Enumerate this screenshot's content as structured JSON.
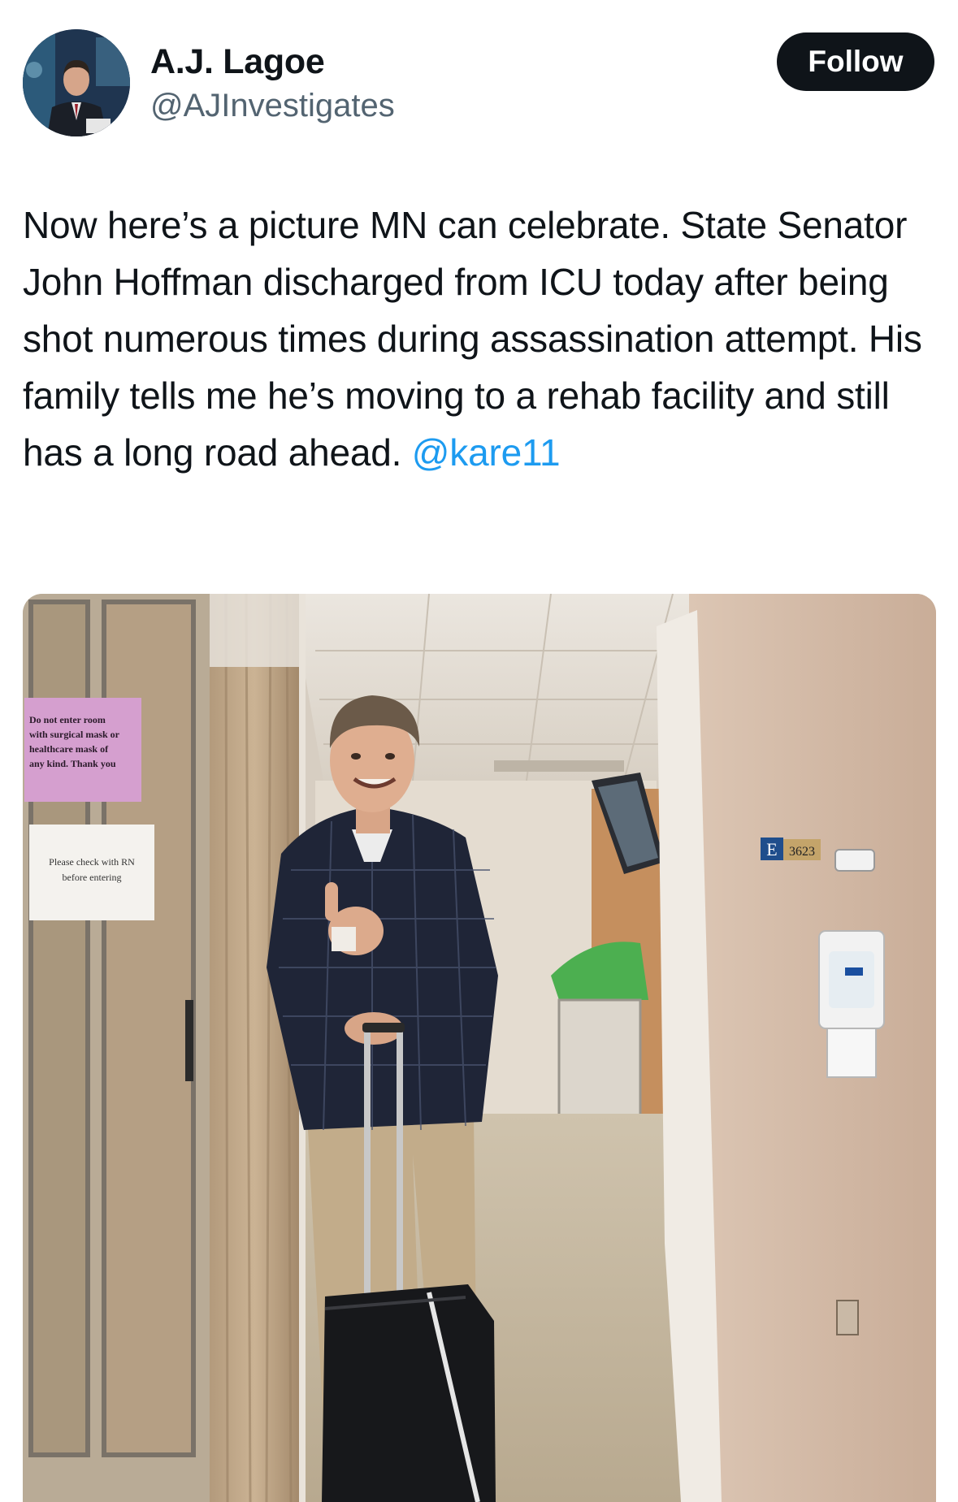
{
  "author": {
    "display_name": "A.J. Lagoe",
    "handle": "@AJInvestigates",
    "avatar_icon": "profile-photo"
  },
  "follow_label": "Follow",
  "tweet": {
    "text_part1": "Now here’s a picture MN can celebrate. State Senator John Hoffman discharged from ICU today after being shot numerous times during assassination attempt. His family tells me he’s moving to a rehab facility and still has a long road ahead.",
    "mention": "@kare11"
  },
  "photo": {
    "sign_mask": [
      "Do not enter room",
      "with surgical mask or",
      "healthcare mask of",
      "any kind.   Thank you"
    ],
    "sign_rn": [
      "Please check with RN",
      "before entering"
    ],
    "room_letter": "E",
    "room_number": "3623"
  },
  "colors": {
    "mention": "#1d9bf0",
    "follow_bg": "#0f1419",
    "handle": "#536471"
  }
}
